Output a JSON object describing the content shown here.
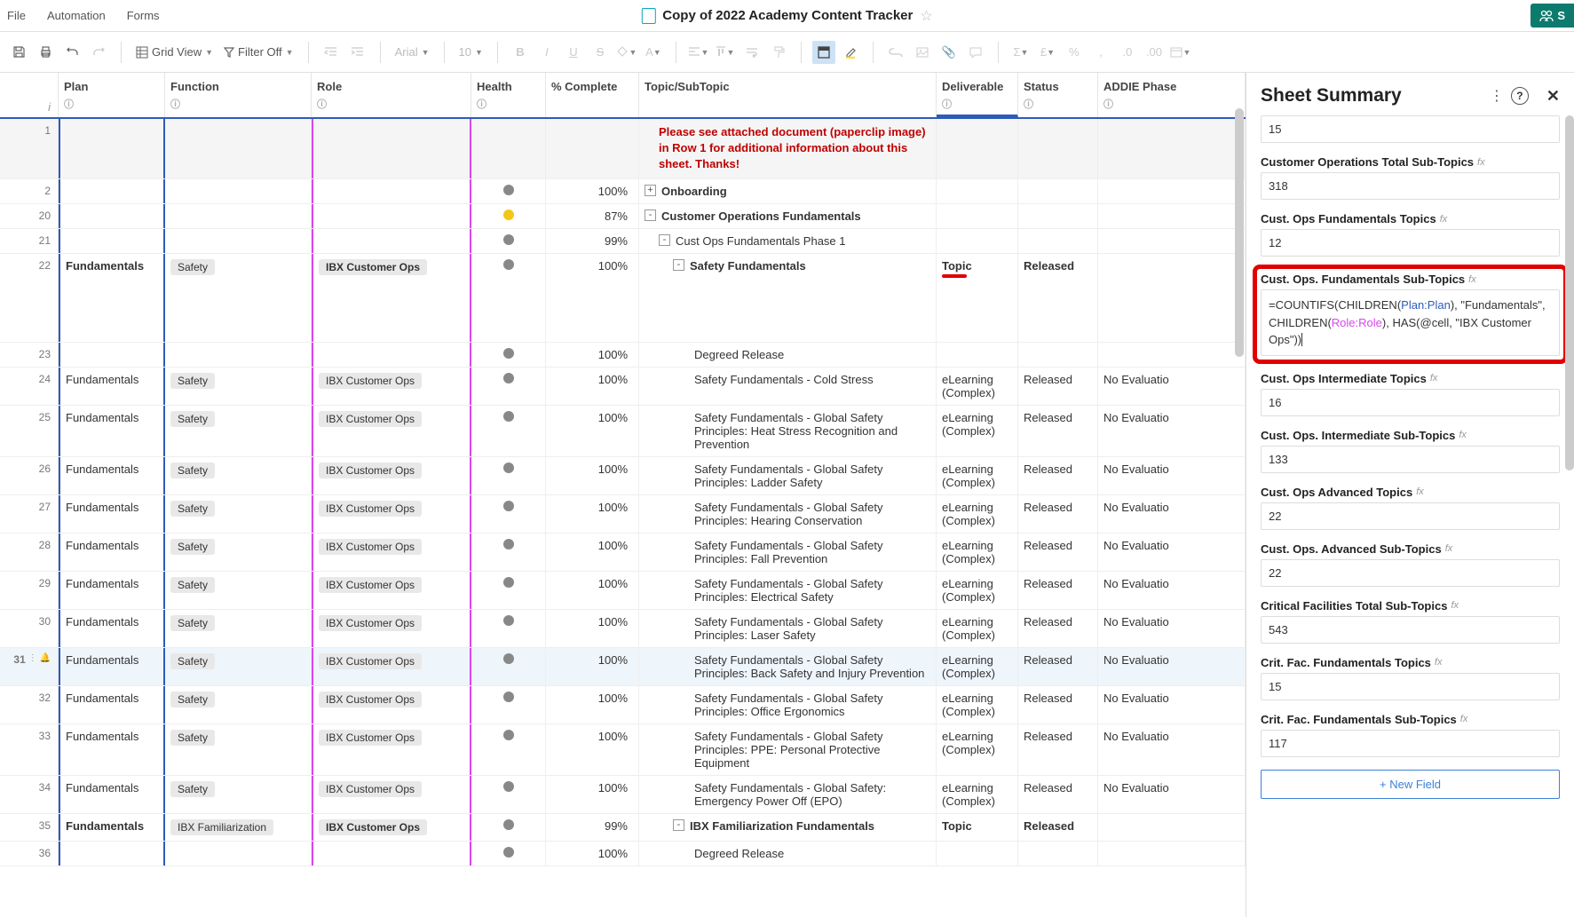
{
  "menubar": {
    "file": "File",
    "automation": "Automation",
    "forms": "Forms",
    "doc_title": "Copy of 2022 Academy Content Tracker",
    "share": "S"
  },
  "toolbar": {
    "grid_view": "Grid View",
    "filter_off": "Filter Off",
    "font": "Arial",
    "font_size": "10"
  },
  "columns": {
    "plan": "Plan",
    "function": "Function",
    "role": "Role",
    "health": "Health",
    "complete": "% Complete",
    "topic": "Topic/SubTopic",
    "deliverable": "Deliverable",
    "status": "Status",
    "phase": "ADDIE Phase"
  },
  "row1_message": "Please see attached document (paperclip image) in Row 1 for additional information about this sheet. Thanks!",
  "rows": [
    {
      "num": "1",
      "plan": "",
      "func": "",
      "role": "",
      "health": "",
      "complete": "",
      "topic_msg": true,
      "deliv": "",
      "status": "",
      "phase": ""
    },
    {
      "num": "2",
      "plan": "",
      "func": "",
      "role": "",
      "health": "gray",
      "complete": "100%",
      "topic": "Onboarding",
      "bold": true,
      "collapse": "+",
      "indent": 0,
      "deliv": "",
      "status": "",
      "phase": ""
    },
    {
      "num": "20",
      "plan": "",
      "func": "",
      "role": "",
      "health": "yellow",
      "complete": "87%",
      "topic": "Customer Operations Fundamentals",
      "bold": true,
      "collapse": "-",
      "indent": 0,
      "deliv": "",
      "status": "",
      "phase": ""
    },
    {
      "num": "21",
      "plan": "",
      "func": "",
      "role": "",
      "health": "gray",
      "complete": "99%",
      "topic": "Cust Ops Fundamentals Phase 1",
      "collapse": "-",
      "indent": 1,
      "deliv": "",
      "status": "",
      "phase": ""
    },
    {
      "num": "22",
      "plan": "Fundamentals",
      "plan_bold": true,
      "func": "Safety",
      "role": "IBX Customer Ops",
      "role_bold": true,
      "health": "gray",
      "complete": "100%",
      "topic": "Safety Fundamentals",
      "bold": true,
      "collapse": "-",
      "indent": 2,
      "deliv": "Topic",
      "deliv_bold": true,
      "deliv_underline": true,
      "status": "Released",
      "status_bold": true,
      "phase": "",
      "tall": true
    },
    {
      "num": "23",
      "plan": "",
      "func": "",
      "role": "",
      "health": "gray",
      "complete": "100%",
      "topic": "Degreed Release",
      "indent": 4,
      "deliv": "",
      "status": "",
      "phase": ""
    },
    {
      "num": "24",
      "plan": "Fundamentals",
      "func": "Safety",
      "role": "IBX Customer Ops",
      "health": "gray",
      "complete": "100%",
      "topic": "Safety Fundamentals - Cold Stress",
      "indent": 4,
      "deliv": "eLearning (Complex)",
      "status": "Released",
      "phase": "No Evaluatio"
    },
    {
      "num": "25",
      "plan": "Fundamentals",
      "func": "Safety",
      "role": "IBX Customer Ops",
      "health": "gray",
      "complete": "100%",
      "topic": "Safety Fundamentals - Global Safety Principles: Heat Stress Recognition and Prevention",
      "indent": 4,
      "deliv": "eLearning (Complex)",
      "status": "Released",
      "phase": "No Evaluatio"
    },
    {
      "num": "26",
      "plan": "Fundamentals",
      "func": "Safety",
      "role": "IBX Customer Ops",
      "health": "gray",
      "complete": "100%",
      "topic": "Safety Fundamentals - Global Safety Principles: Ladder Safety",
      "indent": 4,
      "deliv": "eLearning (Complex)",
      "status": "Released",
      "phase": "No Evaluatio"
    },
    {
      "num": "27",
      "plan": "Fundamentals",
      "func": "Safety",
      "role": "IBX Customer Ops",
      "health": "gray",
      "complete": "100%",
      "topic": "Safety Fundamentals - Global Safety Principles: Hearing Conservation",
      "indent": 4,
      "deliv": "eLearning (Complex)",
      "status": "Released",
      "phase": "No Evaluatio"
    },
    {
      "num": "28",
      "plan": "Fundamentals",
      "func": "Safety",
      "role": "IBX Customer Ops",
      "health": "gray",
      "complete": "100%",
      "topic": "Safety Fundamentals - Global Safety Principles: Fall Prevention",
      "indent": 4,
      "deliv": "eLearning (Complex)",
      "status": "Released",
      "phase": "No Evaluatio"
    },
    {
      "num": "29",
      "plan": "Fundamentals",
      "func": "Safety",
      "role": "IBX Customer Ops",
      "health": "gray",
      "complete": "100%",
      "topic": "Safety Fundamentals - Global Safety Principles: Electrical Safety",
      "indent": 4,
      "deliv": "eLearning (Complex)",
      "status": "Released",
      "phase": "No Evaluatio"
    },
    {
      "num": "30",
      "plan": "Fundamentals",
      "func": "Safety",
      "role": "IBX Customer Ops",
      "health": "gray",
      "complete": "100%",
      "topic": "Safety Fundamentals - Global Safety Principles: Laser Safety",
      "indent": 4,
      "deliv": "eLearning (Complex)",
      "status": "Released",
      "phase": "No Evaluatio"
    },
    {
      "num": "31",
      "plan": "Fundamentals",
      "func": "Safety",
      "role": "IBX Customer Ops",
      "health": "gray",
      "complete": "100%",
      "topic": "Safety Fundamentals - Global Safety Principles: Back Safety and Injury Prevention",
      "indent": 4,
      "deliv": "eLearning (Complex)",
      "status": "Released",
      "phase": "No Evaluatio",
      "hovered": true,
      "row_icons": true
    },
    {
      "num": "32",
      "plan": "Fundamentals",
      "func": "Safety",
      "role": "IBX Customer Ops",
      "health": "gray",
      "complete": "100%",
      "topic": "Safety Fundamentals - Global Safety Principles: Office Ergonomics",
      "indent": 4,
      "deliv": "eLearning (Complex)",
      "status": "Released",
      "phase": "No Evaluatio"
    },
    {
      "num": "33",
      "plan": "Fundamentals",
      "func": "Safety",
      "role": "IBX Customer Ops",
      "health": "gray",
      "complete": "100%",
      "topic": "Safety Fundamentals - Global Safety Principles: PPE: Personal Protective Equipment",
      "indent": 4,
      "deliv": "eLearning (Complex)",
      "status": "Released",
      "phase": "No Evaluatio"
    },
    {
      "num": "34",
      "plan": "Fundamentals",
      "func": "Safety",
      "role": "IBX Customer Ops",
      "health": "gray",
      "complete": "100%",
      "topic": "Safety Fundamentals - Global Safety: Emergency Power Off (EPO)",
      "indent": 4,
      "deliv": "eLearning (Complex)",
      "status": "Released",
      "phase": "No Evaluatio"
    },
    {
      "num": "35",
      "plan": "Fundamentals",
      "plan_bold": true,
      "func": "IBX Familiarization",
      "func_pill": true,
      "role": "IBX Customer Ops",
      "role_bold": true,
      "health": "gray",
      "complete": "99%",
      "topic": "IBX Familiarization Fundamentals",
      "bold": true,
      "collapse": "-",
      "indent": 2,
      "deliv": "Topic",
      "deliv_bold": true,
      "status": "Released",
      "status_bold": true,
      "phase": ""
    },
    {
      "num": "36",
      "plan": "",
      "func": "",
      "role": "",
      "health": "gray",
      "complete": "100%",
      "topic": "Degreed Release",
      "indent": 4,
      "deliv": "",
      "status": "",
      "phase": ""
    }
  ],
  "summary": {
    "title": "Sheet Summary",
    "fields": [
      {
        "label_hidden": true,
        "value": "15"
      },
      {
        "label": "Customer Operations Total Sub-Topics",
        "fx": true,
        "value": "318"
      },
      {
        "label": "Cust. Ops Fundamentals Topics",
        "fx": true,
        "value": "12"
      },
      {
        "label": "Cust. Ops. Fundamentals Sub-Topics",
        "fx": true,
        "highlighted": true,
        "formula": true
      },
      {
        "label": "Cust. Ops Intermediate Topics",
        "fx": true,
        "value": "16"
      },
      {
        "label": "Cust. Ops. Intermediate Sub-Topics",
        "fx": true,
        "value": "133"
      },
      {
        "label": "Cust. Ops Advanced Topics",
        "fx": true,
        "value": "22"
      },
      {
        "label": "Cust. Ops. Advanced Sub-Topics",
        "fx": true,
        "value": "22"
      },
      {
        "label": "Critical Facilities Total Sub-Topics",
        "fx": true,
        "value": "543"
      },
      {
        "label": "Crit. Fac. Fundamentals Topics",
        "fx": true,
        "value": "15"
      },
      {
        "label": "Crit. Fac. Fundamentals Sub-Topics",
        "fx": true,
        "value": "117"
      }
    ],
    "formula_parts": {
      "p1": "=COUNTIFS(CHILDREN(",
      "plan": "Plan:Plan",
      "p2": "), \"Fundamentals\", CHILDREN(",
      "role": "Role:Role",
      "p3": "), HAS(@cell, \"IBX Customer Ops\"))"
    },
    "new_field": "+ New Field"
  }
}
